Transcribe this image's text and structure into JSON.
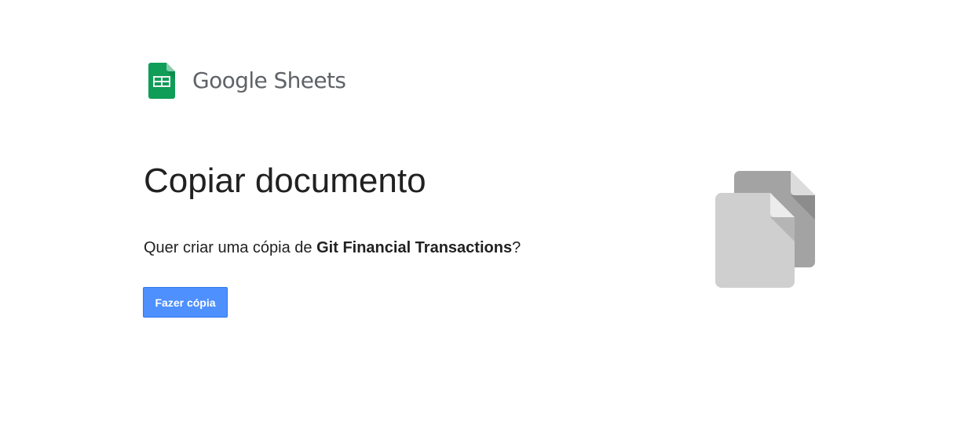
{
  "brand": {
    "name": "Google Sheets",
    "logo_icon": "google-sheets-logo",
    "logo_color": "#0f9d58"
  },
  "dialog": {
    "title": "Copiar documento",
    "prompt_prefix": "Quer criar uma cópia de ",
    "document_name": "Git Financial Transactions",
    "prompt_suffix": "?",
    "copy_button_label": "Fazer cópia",
    "button_color": "#4d90fe",
    "illustration_icon": "copy-documents-icon"
  }
}
